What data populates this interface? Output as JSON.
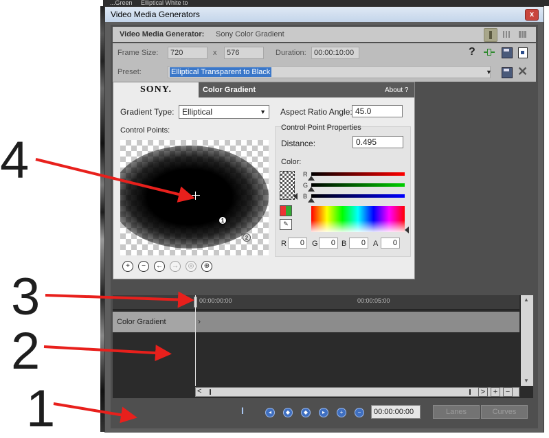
{
  "background_strip": {
    "text1": "...Green",
    "text2": "Elliptical White to"
  },
  "window": {
    "title": "Video Media Generators",
    "close_label": "x"
  },
  "header": {
    "label": "Video Media Generator:",
    "value": "Sony Color Gradient"
  },
  "frame": {
    "size_label": "Frame Size:",
    "width": "720",
    "x": "x",
    "height": "576",
    "duration_label": "Duration:",
    "duration": "00:00:10:00",
    "help": "?"
  },
  "preset": {
    "label": "Preset:",
    "value": "Elliptical Transparent to Black"
  },
  "plugin": {
    "brand": "SONY.",
    "title": "Color Gradient",
    "about": "About  ?",
    "gradient_type_label": "Gradient Type:",
    "gradient_type": "Elliptical",
    "control_points_label": "Control Points:",
    "aspect_label": "Aspect Ratio Angle:",
    "aspect_value": "45.0",
    "cp_props_label": "Control Point Properties",
    "distance_label": "Distance:",
    "distance_value": "0.495",
    "color_label": "Color:",
    "r": "R",
    "g": "G",
    "b": "B",
    "a": "A",
    "r_val": "0",
    "g_val": "0",
    "b_val": "0",
    "a_val": "0",
    "point1": "1",
    "point2": "2"
  },
  "timeline": {
    "tick0": "00:00:00:00",
    "tick1": "00:00:05:00",
    "track_name": "Color Gradient"
  },
  "bottom": {
    "time": "00:00:00:00",
    "lanes": "Lanes",
    "curves": "Curves"
  },
  "annotations": {
    "n1": "1",
    "n2": "2",
    "n3": "3",
    "n4": "4"
  },
  "colors": {
    "arrow": "#e8201c",
    "accent": "#3a77c9"
  }
}
